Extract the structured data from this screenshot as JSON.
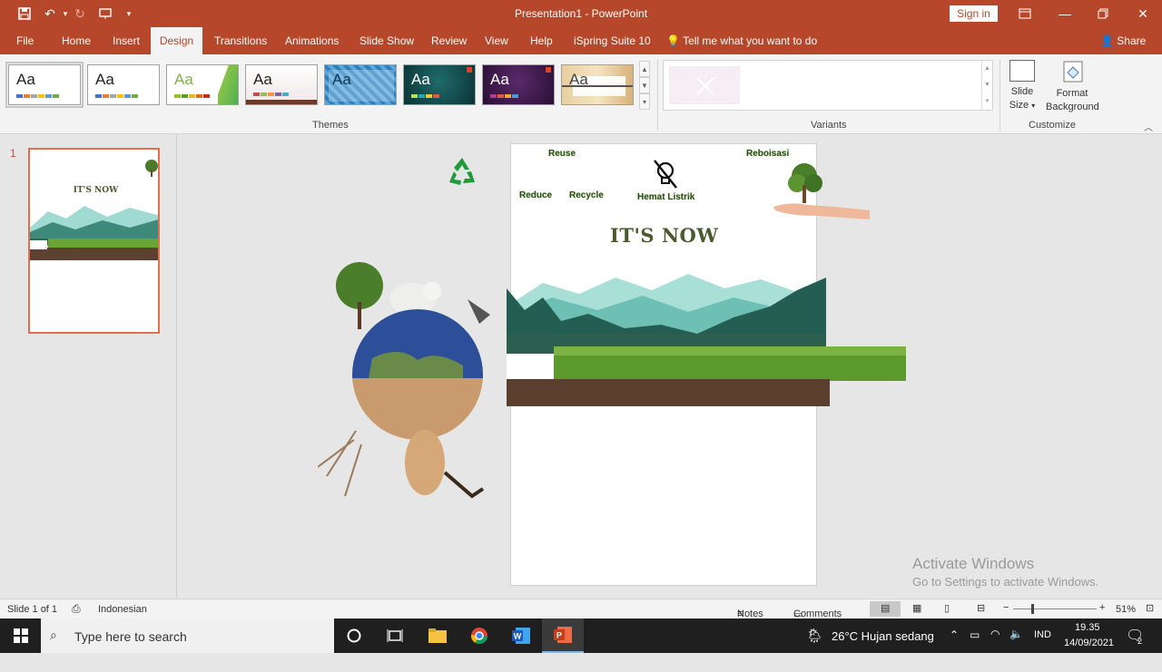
{
  "window": {
    "title": "Presentation1  -  PowerPoint",
    "signin": "Sign in"
  },
  "tabs": [
    "File",
    "Home",
    "Insert",
    "Design",
    "Transitions",
    "Animations",
    "Slide Show",
    "Review",
    "View",
    "Help",
    "iSpring Suite 10"
  ],
  "active_tab": "Design",
  "tell_me": "Tell me what you want to do",
  "share": "Share",
  "ribbon": {
    "themes_label": "Themes",
    "variants_label": "Variants",
    "customize_label": "Customize",
    "theme_glyph": "Aa",
    "slide_size_line1": "Slide",
    "slide_size_line2": "Size",
    "format_bg_line1": "Format",
    "format_bg_line2": "Background"
  },
  "thumbnail": {
    "number": "1",
    "title": "IT'S NOW"
  },
  "slide": {
    "reuse": "Reuse",
    "reboisasi": "Reboisasi",
    "reduce": "Reduce",
    "recycle": "Recycle",
    "hemat": "Hemat Listrik",
    "heading": "IT'S NOW"
  },
  "status": {
    "slide_count": "Slide 1 of 1",
    "language": "Indonesian",
    "notes": "Notes",
    "comments": "Comments",
    "zoom": "51%"
  },
  "watermark": {
    "line1": "Activate Windows",
    "line2": "Go to Settings to activate Windows."
  },
  "taskbar": {
    "search_placeholder": "Type here to search",
    "weather": "26°C  Hujan sedang",
    "lang": "IND",
    "time": "19.35",
    "date": "14/09/2021",
    "notif_count": "2"
  },
  "colors": {
    "accent": "#b7472a",
    "ribbon_bg": "#f3f3f3",
    "thumb_border": "#e07150"
  }
}
